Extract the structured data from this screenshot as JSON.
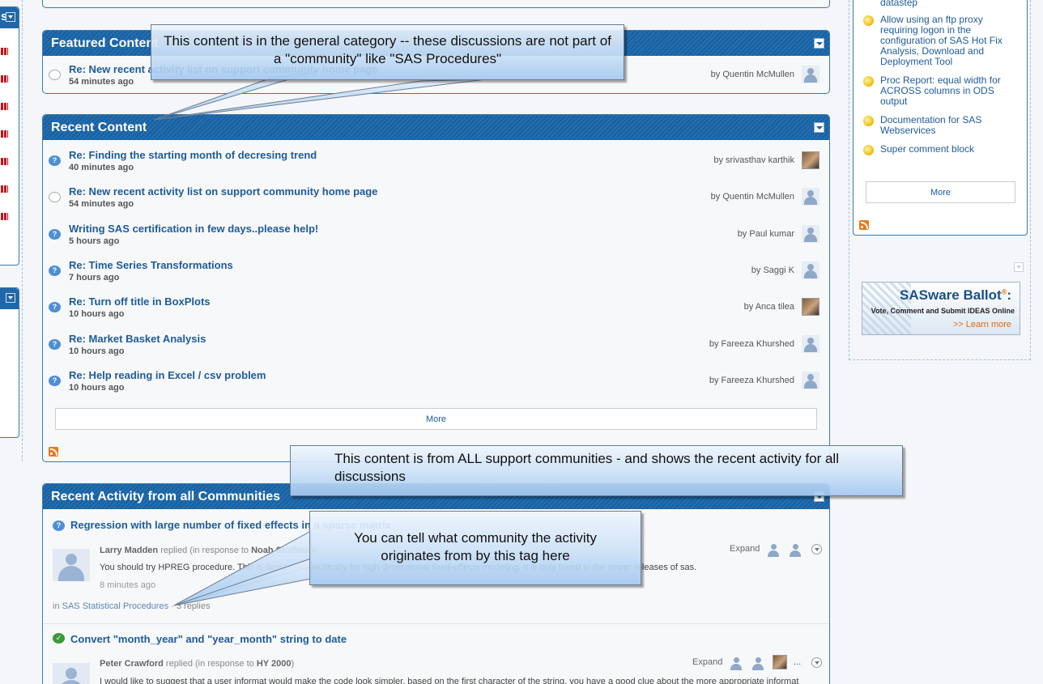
{
  "left_sidebar": {
    "header_fragment": "s"
  },
  "featured": {
    "title": "Featured Content",
    "items": [
      {
        "title": "Re: New recent activity list on support community home page",
        "age": "54 minutes ago",
        "by": "by Quentin McMullen",
        "icon": "comment-icon",
        "avatar": "default"
      }
    ]
  },
  "recent": {
    "title": "Recent Content",
    "items": [
      {
        "title": "Re: Finding the starting month of decresing trend",
        "age": "40 minutes ago",
        "by": "by srivasthav karthik",
        "icon": "question-icon",
        "avatar": "photo"
      },
      {
        "title": "Re: New recent activity list on support community home page",
        "age": "54 minutes ago",
        "by": "by Quentin McMullen",
        "icon": "comment-icon",
        "avatar": "default"
      },
      {
        "title": "Writing SAS certification in few days..please help!",
        "age": "5 hours ago",
        "by": "by Paul kumar",
        "icon": "question-icon",
        "avatar": "default"
      },
      {
        "title": "Re: Time Series Transformations",
        "age": "7 hours ago",
        "by": "by Saggi K",
        "icon": "question-icon",
        "avatar": "default"
      },
      {
        "title": "Re: Turn off title in BoxPlots",
        "age": "10 hours ago",
        "by": "by Anca tilea",
        "icon": "question-icon",
        "avatar": "photo"
      },
      {
        "title": "Re: Market Basket Analysis",
        "age": "10 hours ago",
        "by": "by Fareeza Khurshed",
        "icon": "question-icon",
        "avatar": "default"
      },
      {
        "title": "Re: Help reading in Excel / csv problem",
        "age": "10 hours ago",
        "by": "by Fareeza Khurshed",
        "icon": "question-icon",
        "avatar": "default"
      }
    ],
    "more_label": "More"
  },
  "activity": {
    "title": "Recent Activity from all Communities",
    "entries": [
      {
        "title": "Regression with large number of fixed effects in a sparse matrix",
        "author": "Larry Madden",
        "replied": "replied (in response to",
        "respondent": "Noah Stoffman",
        "close": ")",
        "text": "You should try HPREG procedure. This is designed specifically for high dimensional fixed-effects modeling. It is only found in the newer releases of sas.",
        "time": "8 minutes ago",
        "tag_prefix": "in",
        "tag": "SAS Statistical Procedures",
        "replies": "· 3 replies",
        "expand": "Expand"
      },
      {
        "title": "Convert \"month_year\" and \"year_month\" string to date",
        "author": "Peter Crawford",
        "replied": "replied (in response to",
        "respondent": "HY 2000",
        "close": ")",
        "text": "I would like to suggest that a user informat would make the code look simpler. based on the first character of the string, you have a good clue about the more appropriate informat",
        "expand": "Expand",
        "ellipsis": "..."
      }
    ]
  },
  "right_sidebar": {
    "top_fragment": "datastep",
    "ideas": [
      "Allow using an ftp proxy requiring logon in the configuration of SAS Hot Fix Analysis, Download and Deployment Tool",
      "Proc Report: equal width for ACROSS columns in ODS output",
      "Documentation for SAS Webservices",
      "Super comment block"
    ],
    "more_label": "More",
    "ballot": {
      "title": "SASware Ballot",
      "reg": "®",
      "colon": ":",
      "subtitle": "Vote, Comment and Submit IDEAS Online",
      "cta": ">> Learn more"
    }
  },
  "callouts": {
    "general": "This content is in the general category -- these discussions are not part of a \"community\" like \"SAS Procedures\"",
    "all_communities": "This content is from ALL support communities - and shows the recent activity for all discussions",
    "tag": "You can tell what community the activity originates from by this tag here"
  },
  "colors": {
    "header_blue": "#1f67a8",
    "link_blue": "#1e5b99",
    "rss_orange": "#e8791c"
  }
}
